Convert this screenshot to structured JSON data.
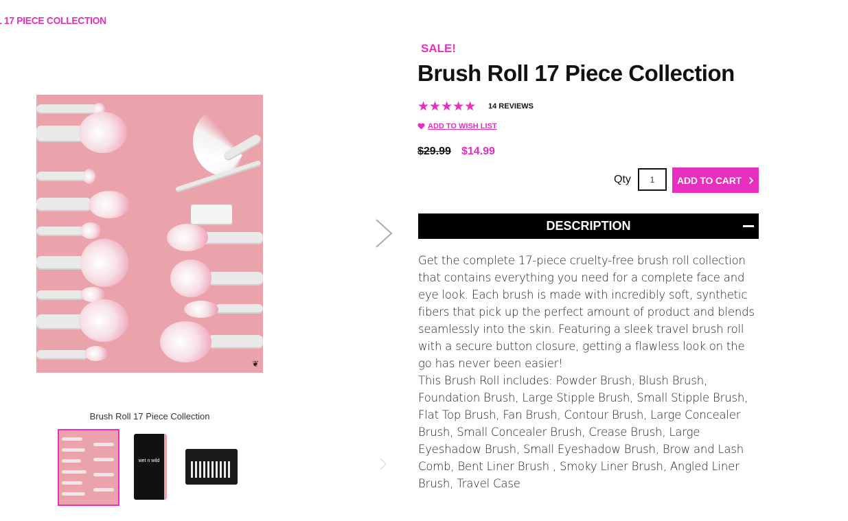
{
  "breadcrumb": {
    "text": "L 17 PIECE COLLECTION"
  },
  "product": {
    "sale_badge": "SALE!",
    "title": "Brush Roll 17 Piece Collection",
    "rating_stars": "★★★★★",
    "reviews": "14 REVIEWS",
    "wishlist_label": "ADD TO WISH LIST",
    "old_price": "$29.99",
    "new_price": "$14.99",
    "qty_label": "Qty",
    "qty_value": "1",
    "add_to_cart": "ADD TO CART",
    "image_caption": "Brush Roll 17 Piece Collection",
    "thumb_brand": "wet n wild"
  },
  "description": {
    "heading": "DESCRIPTION",
    "paragraph1": "Get the complete 17-piece cruelty-free brush roll collection that contains everything you need for a complete face and eye look. Each brush is made with incredibly soft, synthetic fibers that pick up the perfect amount of product and blends seamlessly into the skin. Featuring a sleek travel brush roll with a secure button closure, getting a flawless look on the go has never been easier!",
    "paragraph2": "This Brush Roll includes: Powder Brush, Blush Brush, Foundation Brush, Large Stipple Brush, Small Stipple Brush, Flat Top Brush, Fan Brush, Contour Brush, Large Concealer Brush, Small Concealer Brush, Crease Brush, Large Eyeshadow Brush, Small Eyeshadow Brush, Brow and Lash Comb, Bent Liner Brush , Smoky Liner Brush, Angled Liner Brush, Travel Case"
  },
  "colors": {
    "accent": "#e62fbe",
    "image_bg": "#eba3ab",
    "bar": "#000000"
  },
  "icons": [
    "chevron-right-icon",
    "heart-icon",
    "star-icon",
    "minus-icon"
  ]
}
